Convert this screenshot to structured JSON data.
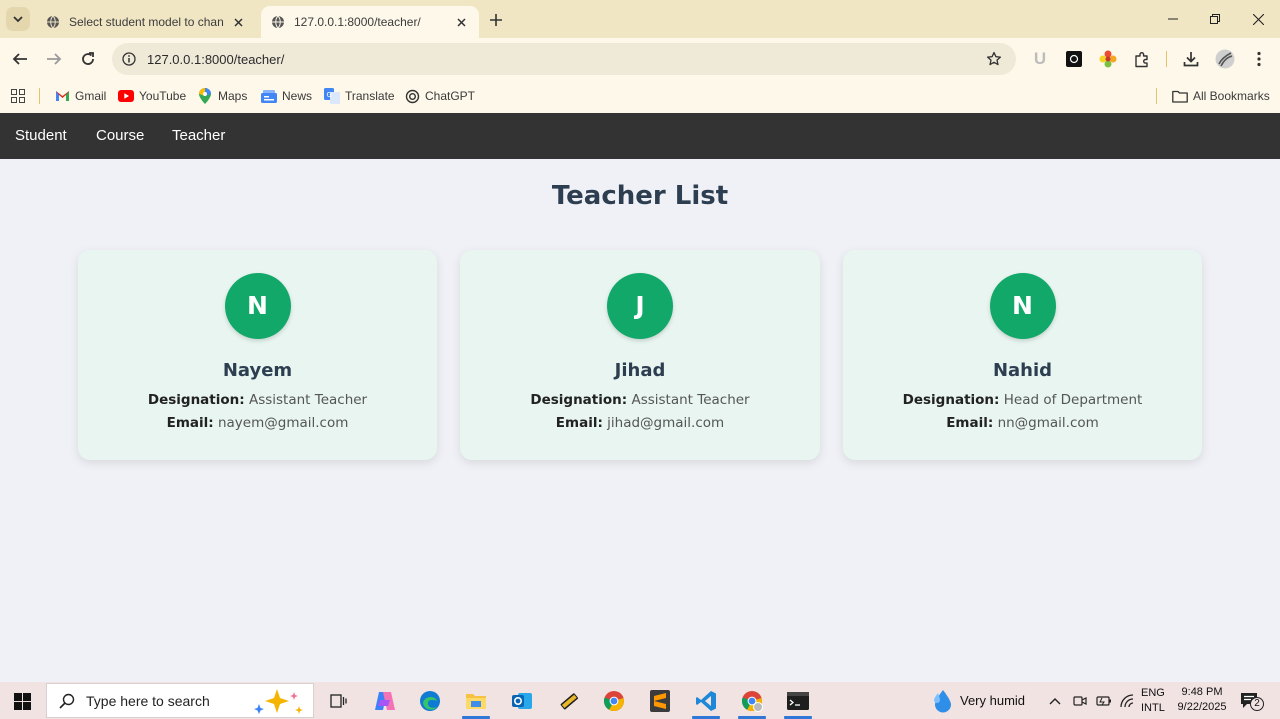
{
  "browser": {
    "tabs": [
      {
        "title": "Select student model to change | Django site admin",
        "active": false
      },
      {
        "title": "127.0.0.1:8000/teacher/",
        "active": true
      }
    ],
    "url": "127.0.0.1:8000/teacher/",
    "bookmarks": [
      {
        "label": "Gmail",
        "icon": "gmail-icon"
      },
      {
        "label": "YouTube",
        "icon": "youtube-icon"
      },
      {
        "label": "Maps",
        "icon": "maps-icon"
      },
      {
        "label": "News",
        "icon": "news-icon"
      },
      {
        "label": "Translate",
        "icon": "translate-icon"
      },
      {
        "label": "ChatGPT",
        "icon": "chatgpt-icon"
      }
    ],
    "all_bookmarks_label": "All Bookmarks",
    "extension_letter": "U"
  },
  "site": {
    "nav": [
      "Student",
      "Course",
      "Teacher"
    ],
    "page_title": "Teacher List",
    "labels": {
      "designation": "Designation:",
      "email": "Email:"
    },
    "teachers": [
      {
        "initial": "N",
        "name": "Nayem",
        "designation": "Assistant Teacher",
        "email": "nayem@gmail.com"
      },
      {
        "initial": "J",
        "name": "Jihad",
        "designation": "Assistant Teacher",
        "email": "jihad@gmail.com"
      },
      {
        "initial": "N",
        "name": "Nahid",
        "designation": "Head of Department",
        "email": "nn@gmail.com"
      }
    ],
    "colors": {
      "nav_bg": "#333333",
      "avatar": "#11a86a",
      "card_bg": "#e8f5f0",
      "title": "#2c3e50"
    }
  },
  "taskbar": {
    "search_placeholder": "Type here to search",
    "weather": "Very humid",
    "language": [
      "ENG",
      "INTL"
    ],
    "time": "9:48 PM",
    "date": "9/22/2025",
    "notification_count": "2"
  }
}
